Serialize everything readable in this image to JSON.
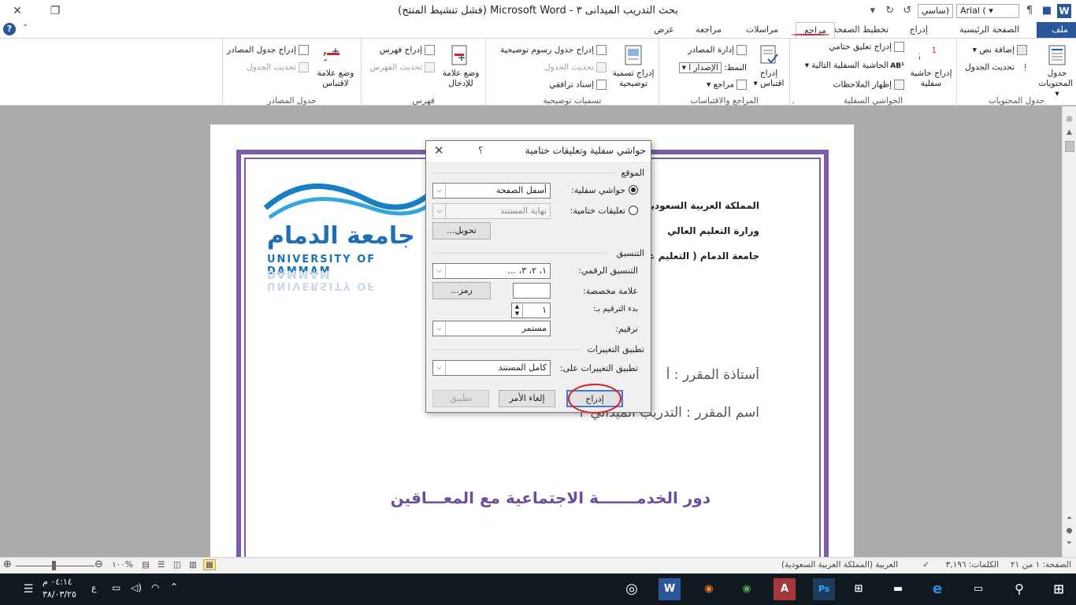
{
  "window": {
    "title": "بحث التدريب الميدانى ٣ - Microsoft Word (فشل تنشيط المنتج)",
    "font_name": "Arial (",
    "style_name": "ساسي)"
  },
  "tabs": [
    {
      "label": "ملف"
    },
    {
      "label": "الصفحة الرئيسية"
    },
    {
      "label": "إدراج"
    },
    {
      "label": "تخطيط الصفحة"
    },
    {
      "label": "مراجع"
    },
    {
      "label": "مراسلات"
    },
    {
      "label": "مراجعة"
    },
    {
      "label": "عرض"
    }
  ],
  "ribbon": {
    "toc": {
      "label": "جدول المحتويات",
      "big": "جدول المحتويات",
      "add_text": "إضافة نص",
      "update_table": "تحديث الجدول"
    },
    "footnotes": {
      "label": "الحواشي السفلية",
      "insert_footnote": "إدراج حاشية سفلية",
      "insert_endnote": "إدراج تعليق ختامي",
      "next_footnote": "الحاشية السفلية التالية",
      "show_notes": "إظهار الملاحظات"
    },
    "citations": {
      "label": "المراجع والاقتباسات",
      "insert_citation": "إدراج اقتباس",
      "manage_sources": "إدارة المصادر",
      "style_label": "النمط:",
      "style_value": "الإصدار ا",
      "bibliography": "مراجع"
    },
    "captions": {
      "label": "تسميات توضيحية",
      "insert_caption": "إدراج تسمية توضيحية",
      "insert_table_figures": "إدراج جدول رسوم توضيحية",
      "update_table": "تحديث الجدول",
      "cross_reference": "إسناد ترافقي"
    },
    "index": {
      "label": "فهرس",
      "mark_entry": "وضع علامة للإدخال",
      "insert_index": "إدراج فهرس",
      "update_index": "تحديث الفهرس"
    },
    "authorities": {
      "label": "جدول المصادر",
      "mark_citation": "وضع علامة لاقتباس",
      "insert_table": "إدراج جدول المصادر",
      "update_table": "تحديث الجدول"
    }
  },
  "document": {
    "line1": "المملكة العربية السعودية",
    "line2": "وزارة  التعليم العالي",
    "line3": "جامعة الدمام ( التعليم عن بعد",
    "instructor": "أستاذة المقرر : أ",
    "course": "اسم المقرر : التدريب الميداني ٣",
    "topic": "دور الخدمـــــــة الاجتماعية مع المعـــاقين",
    "logo_ar": "جامعة الدمام",
    "logo_en": "UNIVERSITY OF DAMMAM"
  },
  "dialog": {
    "title": "حواشي سفلية وتعليقات ختامية",
    "help": "؟",
    "location_section": "الموقع",
    "footnotes_label": "حواشي سفلية:",
    "footnotes_value": "أسفل الصفحة",
    "endnotes_label": "تعليقات ختامية:",
    "endnotes_value": "نهاية المستند",
    "convert_button": "تحويل...",
    "format_section": "التنسيق",
    "number_format_label": "التنسيق الرقمي:",
    "number_format_value": "١، ٢، ٣، ...",
    "custom_mark_label": "علامة مخصصة:",
    "custom_mark_value": "",
    "symbol_button": "رمز...",
    "start_at_label": "بدء الترقيم بـ:",
    "start_at_value": "١",
    "numbering_label": "ترقيم:",
    "numbering_value": "مستمر",
    "apply_section": "تطبيق التغييرات",
    "apply_to_label": "تطبيق التغييرات على:",
    "apply_to_value": "كامل المستند",
    "insert_button": "إدراج",
    "cancel_button": "إلغاء الأمر",
    "apply_button": "تطبيق"
  },
  "status": {
    "page": "الصفحة: ١ من ٢١",
    "words": "الكلمات: ٣,١٩٦",
    "language": "العربية (المملكة العربية السعودية)",
    "zoom": "%١٠٠"
  },
  "taskbar": {
    "time": "٠٤:١٤ م",
    "date": "٣٨/٠٣/٢٥",
    "lang": "ع"
  }
}
